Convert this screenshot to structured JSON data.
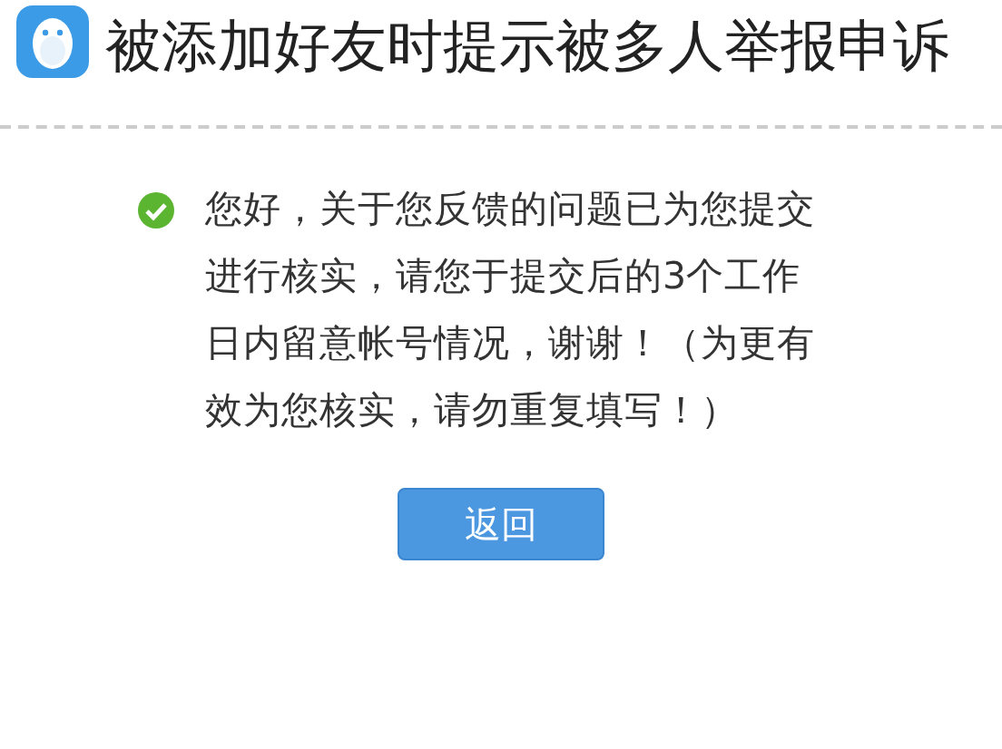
{
  "title": "被添加好友时提示被多人举报申诉",
  "message": {
    "success": true,
    "text": "您好，关于您反馈的问题已为您提交进行核实，请您于提交后的3个工作日内留意帐号情况，谢谢！（为更有效为您核实，请勿重复填写！）"
  },
  "buttons": [
    "返回"
  ]
}
